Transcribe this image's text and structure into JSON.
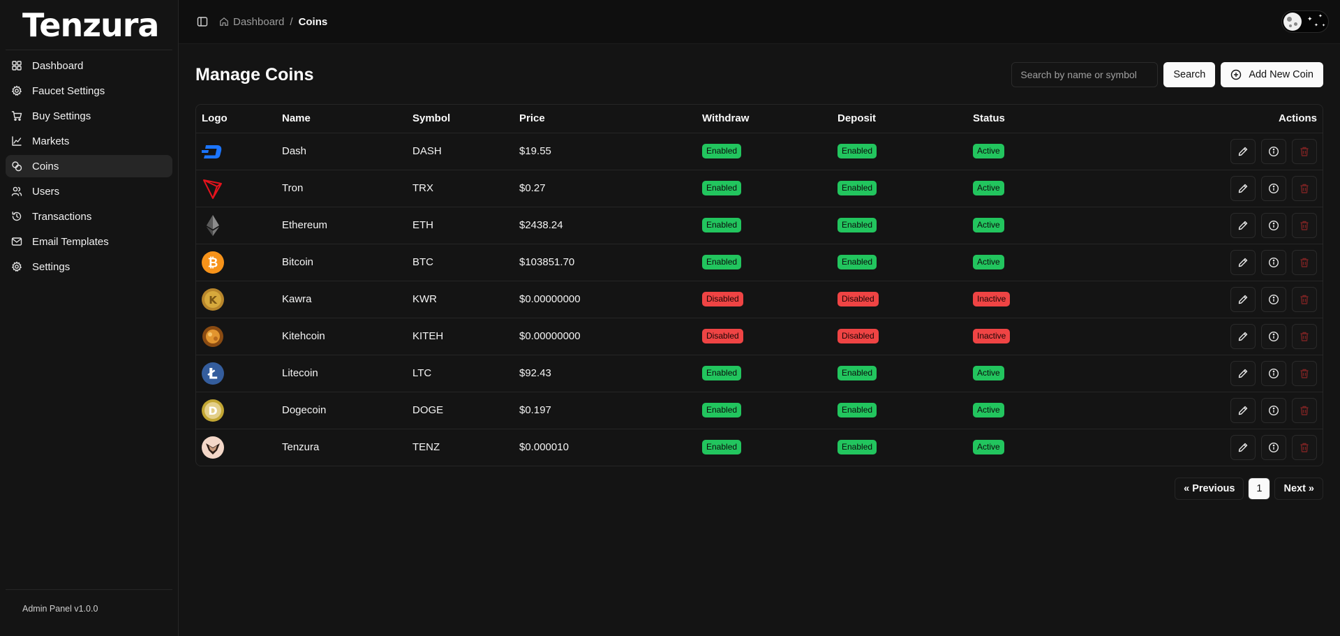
{
  "brand": {
    "name": "Tenzura"
  },
  "sidebar": {
    "items": [
      {
        "label": "Dashboard",
        "icon": "grid-icon",
        "active": false
      },
      {
        "label": "Faucet Settings",
        "icon": "gear-icon",
        "active": false
      },
      {
        "label": "Buy Settings",
        "icon": "cart-icon",
        "active": false
      },
      {
        "label": "Markets",
        "icon": "chart-icon",
        "active": false
      },
      {
        "label": "Coins",
        "icon": "coins-icon",
        "active": true
      },
      {
        "label": "Users",
        "icon": "users-icon",
        "active": false
      },
      {
        "label": "Transactions",
        "icon": "history-icon",
        "active": false
      },
      {
        "label": "Email Templates",
        "icon": "mail-icon",
        "active": false
      },
      {
        "label": "Settings",
        "icon": "gear-icon",
        "active": false
      }
    ],
    "footer": "Admin Panel v1.0.0"
  },
  "breadcrumb": {
    "home": "Dashboard",
    "separator": "/",
    "current": "Coins"
  },
  "page": {
    "title": "Manage Coins",
    "search_placeholder": "Search by name or symbol",
    "search_label": "Search",
    "add_label": "Add New Coin"
  },
  "table": {
    "columns": [
      "Logo",
      "Name",
      "Symbol",
      "Price",
      "Withdraw",
      "Deposit",
      "Status",
      "Actions"
    ],
    "rows": [
      {
        "logo": "dash-logo",
        "name": "Dash",
        "symbol": "DASH",
        "price": "$19.55",
        "withdraw": "Enabled",
        "deposit": "Enabled",
        "status": "Active"
      },
      {
        "logo": "tron-logo",
        "name": "Tron",
        "symbol": "TRX",
        "price": "$0.27",
        "withdraw": "Enabled",
        "deposit": "Enabled",
        "status": "Active"
      },
      {
        "logo": "ethereum-logo",
        "name": "Ethereum",
        "symbol": "ETH",
        "price": "$2438.24",
        "withdraw": "Enabled",
        "deposit": "Enabled",
        "status": "Active"
      },
      {
        "logo": "bitcoin-logo",
        "name": "Bitcoin",
        "symbol": "BTC",
        "price": "$103851.70",
        "withdraw": "Enabled",
        "deposit": "Enabled",
        "status": "Active"
      },
      {
        "logo": "kawra-logo",
        "name": "Kawra",
        "symbol": "KWR",
        "price": "$0.00000000",
        "withdraw": "Disabled",
        "deposit": "Disabled",
        "status": "Inactive"
      },
      {
        "logo": "kitehcoin-logo",
        "name": "Kitehcoin",
        "symbol": "KITEH",
        "price": "$0.00000000",
        "withdraw": "Disabled",
        "deposit": "Disabled",
        "status": "Inactive"
      },
      {
        "logo": "litecoin-logo",
        "name": "Litecoin",
        "symbol": "LTC",
        "price": "$92.43",
        "withdraw": "Enabled",
        "deposit": "Enabled",
        "status": "Active"
      },
      {
        "logo": "dogecoin-logo",
        "name": "Dogecoin",
        "symbol": "DOGE",
        "price": "$0.197",
        "withdraw": "Enabled",
        "deposit": "Enabled",
        "status": "Active"
      },
      {
        "logo": "tenzura-logo",
        "name": "Tenzura",
        "symbol": "TENZ",
        "price": "$0.000010",
        "withdraw": "Enabled",
        "deposit": "Enabled",
        "status": "Active"
      }
    ]
  },
  "pagination": {
    "previous": "« Previous",
    "current": "1",
    "next": "Next »"
  },
  "colors": {
    "enabled": "#22c55e",
    "disabled": "#ef4444",
    "accent": "#fafafa",
    "background": "#141414"
  }
}
